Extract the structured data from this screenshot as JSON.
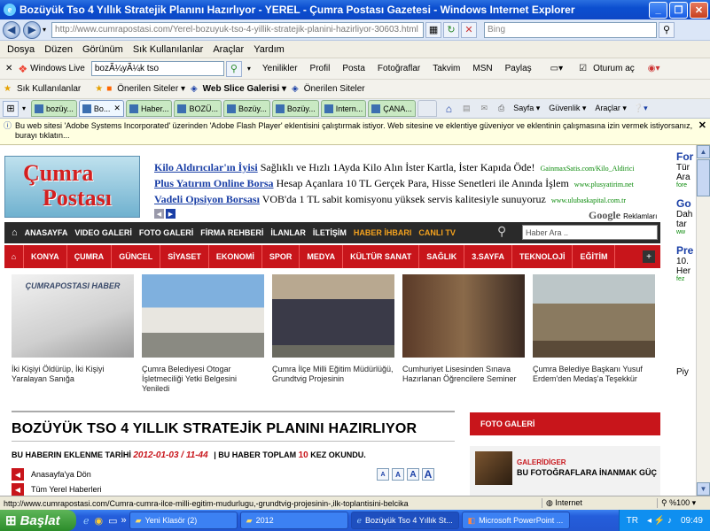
{
  "window": {
    "title": "Bozüyük Tso 4 Yıllık Stratejik Planını Hazırlıyor - YEREL - Çumra Postası Gazetesi - Windows Internet Explorer"
  },
  "address": {
    "url": "http://www.cumrapostasi.com/Yerel-bozuyuk-tso-4-yillik-stratejik-planini-hazirliyor-30603.html",
    "search_placeholder": "Bing"
  },
  "menu": [
    "Dosya",
    "Düzen",
    "Görünüm",
    "Sık Kullanılanlar",
    "Araçlar",
    "Yardım"
  ],
  "live_toolbar": {
    "brand": "Windows Live",
    "search_value": "bozÃ¼yÃ¼k tso",
    "items": [
      "Yenilikler",
      "Profil",
      "Posta",
      "Fotoğraflar",
      "Takvim",
      "MSN",
      "Paylaş"
    ],
    "signin": "Oturum aç"
  },
  "favorites_bar": {
    "favorites": "Sık Kullanılanlar",
    "items": [
      "Önerilen Siteler ▾",
      "Web Slice Galerisi ▾",
      "Önerilen Siteler"
    ]
  },
  "tabs": [
    "bozüy...",
    "Bo...",
    "Haber...",
    "BOZÜ...",
    "Bozüy...",
    "Bozüy...",
    "Intern...",
    "ÇANA..."
  ],
  "command_bar": {
    "page": "Sayfa ▾",
    "safety": "Güvenlik ▾",
    "tools": "Araçlar ▾"
  },
  "infobar": {
    "message": "Bu web sitesi 'Adobe Systems Incorporated' üzerinden 'Adobe Flash Player' eklentisini çalıştırmak istiyor. Web sitesine ve eklentiye güveniyor ve eklentinin çalışmasına izin vermek istiyorsanız, burayı tıklatın..."
  },
  "site": {
    "logo_line1": "Çumra",
    "logo_line2": "Postası",
    "ads": [
      {
        "head": "Kilo Aldırıcılar'ın İyisi",
        "body": "Sağlıklı ve Hızlı 1Ayda Kilo Alın İster Kartla, İster Kapıda Öde!",
        "url": "GainmaxSatis.com/Kilo_Aldirici"
      },
      {
        "head": "Plus Yatırım Online Borsa",
        "body": "Hesap Açanlara 10 TL Gerçek Para, Hisse Senetleri ile Anında İşlem",
        "url": "www.plusyatirim.net"
      },
      {
        "head": "Vadeli Opsiyon Borsası",
        "body": "VOB'da 1 TL sabit komisyonu yüksek servis kalitesiyle sunuyoruz",
        "url": "www.ulubaskapital.com.tr"
      }
    ],
    "ads_brand": "Google",
    "ads_label": "Reklamları",
    "main_nav": [
      "ANASAYFA",
      "VIDEO GALERİ",
      "FOTO GALERİ",
      "FİRMA REHBERİ",
      "İLANLAR",
      "İLETİŞİM",
      "HABER İHBARI",
      "CANLI TV"
    ],
    "search_placeholder": "Haber Ara ..",
    "categories": [
      "KONYA",
      "ÇUMRA",
      "GÜNCEL",
      "SİYASET",
      "EKONOMİ",
      "SPOR",
      "MEDYA",
      "KÜLTÜR SANAT",
      "SAĞLIK",
      "3.SAYFA",
      "TEKNOLOJİ",
      "EĞİTİM"
    ],
    "news_stamp": "ÇUMRAPOSTASI HABER",
    "news": [
      {
        "caption": "İki Kişiyi Öldürüp, İki Kişiyi Yaralayan Sanığa"
      },
      {
        "caption": "Çumra Belediyesi Otogar İşletmeciliği Yetki Belgesini Yeniledi"
      },
      {
        "caption": "Çumra İlçe Milli Eğitim Müdürlüğü, Grundtvig Projesinin"
      },
      {
        "caption": "Cumhuriyet Lisesinden Sınava Hazırlanan Öğrencilere Seminer"
      },
      {
        "caption": "Çumra Belediye Başkanı Yusuf Erdem'den Medaş'a Teşekkür"
      }
    ],
    "article": {
      "title": "BOZÜYÜK TSO 4 YILLIK STRATEJİK PLANINI HAZIRLIYOR",
      "meta_prefix": "BU HABERIN EKLENME TARİHİ",
      "date": "2012-01-03 / 11-44",
      "count_prefix": "BU HABER TOPLAM",
      "count": "10",
      "count_suffix": "KEZ OKUNDU.",
      "links": [
        "Anasayfa'ya Dön",
        "Tüm Yerel Haberleri"
      ],
      "font_sizes": [
        "A",
        "A",
        "A",
        "A"
      ]
    },
    "gallery": {
      "header": "FOTO GALERİ",
      "category": "GALERİDİGER",
      "title": "BU FOTOĞRAFLARA İNANMAK GÜÇ"
    },
    "right_partial": [
      "For",
      "Tür",
      "Ara",
      "fore",
      "Go",
      "Dah",
      "tar",
      "ww",
      "Pre",
      "10.",
      "Her",
      "fez",
      "Piy"
    ]
  },
  "status": {
    "url": "http://www.cumrapostasi.com/Cumra-cumra-ilce-milli-egitim-mudurlugu,-grundtvig-projesinin-,ilk-toplantisini-belcika",
    "zone": "Internet",
    "zoom": "%100"
  },
  "taskbar": {
    "start": "Başlat",
    "buttons": [
      "Yeni Klasör (2)",
      "2012",
      "Bozüyük Tso 4 Yıllık St...",
      "Microsoft PowerPoint ..."
    ],
    "lang": "TR",
    "clock": "09:49"
  },
  "colors": {
    "accent_red": "#c8151b",
    "nav_dark": "#2a2a2a",
    "link_blue": "#1a3fa6"
  }
}
